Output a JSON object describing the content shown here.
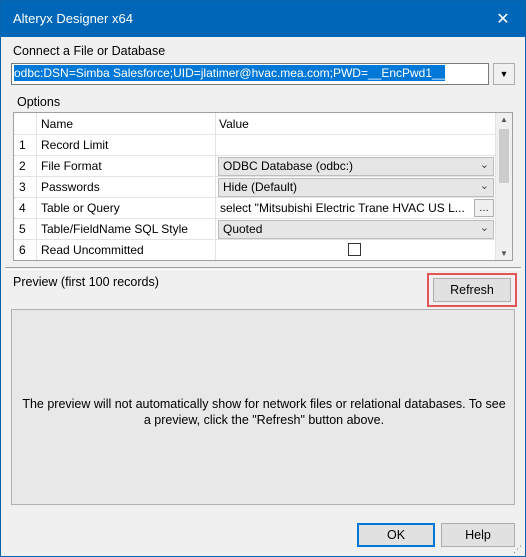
{
  "window": {
    "title": "Alteryx Designer x64"
  },
  "connect": {
    "label": "Connect a File or Database",
    "value": "odbc:DSN=Simba Salesforce;UID=jlatimer@hvac.mea.com;PWD=__EncPwd1__"
  },
  "options": {
    "label": "Options",
    "columns": {
      "name": "Name",
      "value": "Value"
    },
    "rows": [
      {
        "num": "1",
        "name": "Record Limit",
        "value": ""
      },
      {
        "num": "2",
        "name": "File Format",
        "value": "ODBC Database (odbc:)"
      },
      {
        "num": "3",
        "name": "Passwords",
        "value": "Hide (Default)"
      },
      {
        "num": "4",
        "name": "Table or Query",
        "value": "select \"Mitsubishi Electric Trane HVAC US L..."
      },
      {
        "num": "5",
        "name": "Table/FieldName SQL Style",
        "value": "Quoted"
      },
      {
        "num": "6",
        "name": "Read Uncommitted",
        "value": ""
      }
    ]
  },
  "preview": {
    "label": "Preview (first 100 records)",
    "refresh_label": "Refresh",
    "message": "The preview will not automatically show for network files or relational databases. To see a preview, click the \"Refresh\" button above."
  },
  "buttons": {
    "ok": "OK",
    "help": "Help"
  }
}
